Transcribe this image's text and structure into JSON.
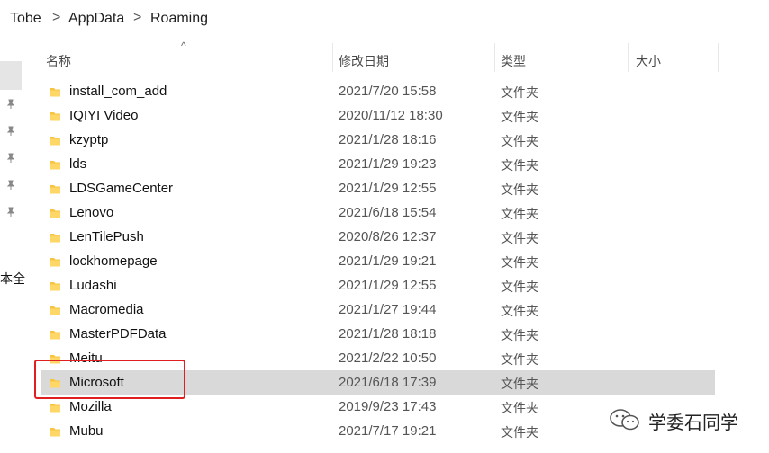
{
  "breadcrumb": {
    "items": [
      "Tobe",
      "AppData",
      "Roaming"
    ],
    "separator": ">"
  },
  "left_nav": {
    "partial_label": "本全"
  },
  "columns": {
    "name": "名称",
    "date": "修改日期",
    "type": "类型",
    "size": "大小"
  },
  "rows": [
    {
      "name": "install_com_add",
      "date": "2021/7/20 15:58",
      "type": "文件夹"
    },
    {
      "name": "IQIYI Video",
      "date": "2020/11/12 18:30",
      "type": "文件夹"
    },
    {
      "name": "kzyptp",
      "date": "2021/1/28 18:16",
      "type": "文件夹"
    },
    {
      "name": "lds",
      "date": "2021/1/29 19:23",
      "type": "文件夹"
    },
    {
      "name": "LDSGameCenter",
      "date": "2021/1/29 12:55",
      "type": "文件夹"
    },
    {
      "name": "Lenovo",
      "date": "2021/6/18 15:54",
      "type": "文件夹"
    },
    {
      "name": "LenTilePush",
      "date": "2020/8/26 12:37",
      "type": "文件夹"
    },
    {
      "name": "lockhomepage",
      "date": "2021/1/29 19:21",
      "type": "文件夹"
    },
    {
      "name": "Ludashi",
      "date": "2021/1/29 12:55",
      "type": "文件夹"
    },
    {
      "name": "Macromedia",
      "date": "2021/1/27 19:44",
      "type": "文件夹"
    },
    {
      "name": "MasterPDFData",
      "date": "2021/1/28 18:18",
      "type": "文件夹"
    },
    {
      "name": "Meitu",
      "date": "2021/2/22 10:50",
      "type": "文件夹"
    },
    {
      "name": "Microsoft",
      "date": "2021/6/18 17:39",
      "type": "文件夹",
      "selected": true
    },
    {
      "name": "Mozilla",
      "date": "2019/9/23 17:43",
      "type": "文件夹"
    },
    {
      "name": "Mubu",
      "date": "2021/7/17 19:21",
      "type": "文件夹"
    }
  ],
  "watermark": {
    "text": "学委石同学",
    "icon": "wechat-icon"
  },
  "colors": {
    "selected_row": "#d9d9d9",
    "highlight_box": "#e02020",
    "folder": "#f5c542"
  }
}
